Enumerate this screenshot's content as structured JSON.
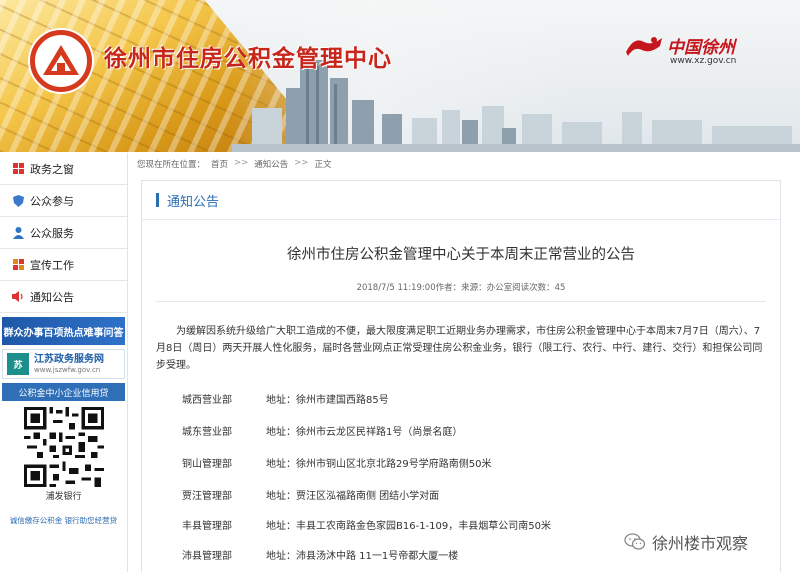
{
  "header": {
    "site_title": "徐州市住房公积金管理中心",
    "portal_title": "中国徐州",
    "portal_url": "www.xz.gov.cn"
  },
  "sidebar": {
    "items": [
      {
        "label": "政务之窗",
        "icon": "grid-icon"
      },
      {
        "label": "公众参与",
        "icon": "shield-icon"
      },
      {
        "label": "公众服务",
        "icon": "person-icon"
      },
      {
        "label": "宣传工作",
        "icon": "tiles-icon"
      },
      {
        "label": "通知公告",
        "icon": "speaker-icon"
      }
    ],
    "promo_banner": "群众办事百项热点难事问答",
    "promo_service_title": "江苏政务服务网",
    "promo_service_url": "www.jszwfw.gov.cn",
    "credit_loan_banner": "公积金中小企业信用贷",
    "qr_caption": "浦发银行",
    "loan_links": "诚信缴存公积金 银行助您经营贷"
  },
  "breadcrumb": {
    "prefix": "您现在所在位置：",
    "home": "首页",
    "section": "通知公告",
    "current": "正文",
    "separator": ">>"
  },
  "panel": {
    "category": "通知公告"
  },
  "article": {
    "title": "徐州市住房公积金管理中心关于本周末正常营业的公告",
    "meta": "2018/7/5 11:19:00作者：来源：办公室阅读次数：45",
    "paragraph": "为缓解因系统升级给广大职工造成的不便，最大限度满足职工近期业务办理需求，市住房公积金管理中心于本周末7月7日（周六）、7月8日（周日）两天开展人性化服务，届时各营业网点正常受理住房公积金业务，银行（限工行、农行、中行、建行、交行）和担保公司同步受理。",
    "branches": [
      {
        "name": "城西营业部",
        "address": "地址：徐州市建国西路85号"
      },
      {
        "name": "城东营业部",
        "address": "地址：徐州市云龙区民祥路1号（尚景名庭）"
      },
      {
        "name": "铜山管理部",
        "address": "地址：徐州市铜山区北京北路29号学府路南侧50米"
      },
      {
        "name": "贾汪管理部",
        "address": "地址：贾汪区泓福路南侧 团结小学对面"
      },
      {
        "name": "丰县管理部",
        "address": "地址：丰县工农南路金色家园B16-1-109，丰县烟草公司南50米"
      },
      {
        "name": "沛县管理部",
        "address": "地址：沛县汤沐中路 11一1号帝都大厦一楼"
      }
    ]
  },
  "watermark": "徐州楼市观察",
  "colors": {
    "brand_red": "#c8261a",
    "link_blue": "#2b6cb5",
    "sidebar_blue": "#2e6fb7"
  }
}
